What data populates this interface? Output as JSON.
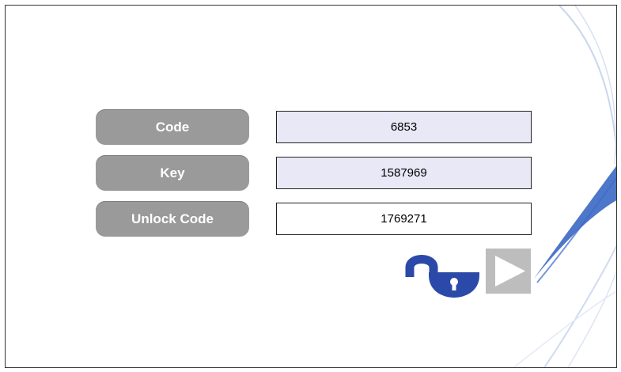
{
  "form": {
    "rows": [
      {
        "label": "Code",
        "value": "6853"
      },
      {
        "label": "Key",
        "value": "1587969"
      },
      {
        "label": "Unlock Code",
        "value": "1769271"
      }
    ]
  },
  "icons": {
    "lock": "unlocked-padlock-icon",
    "next": "play-arrow-icon"
  },
  "colors": {
    "label_bg": "#9a9a9a",
    "field_bg": "#e8e8f6",
    "lock": "#2b49a8",
    "play_bg": "#bdbdbd"
  }
}
